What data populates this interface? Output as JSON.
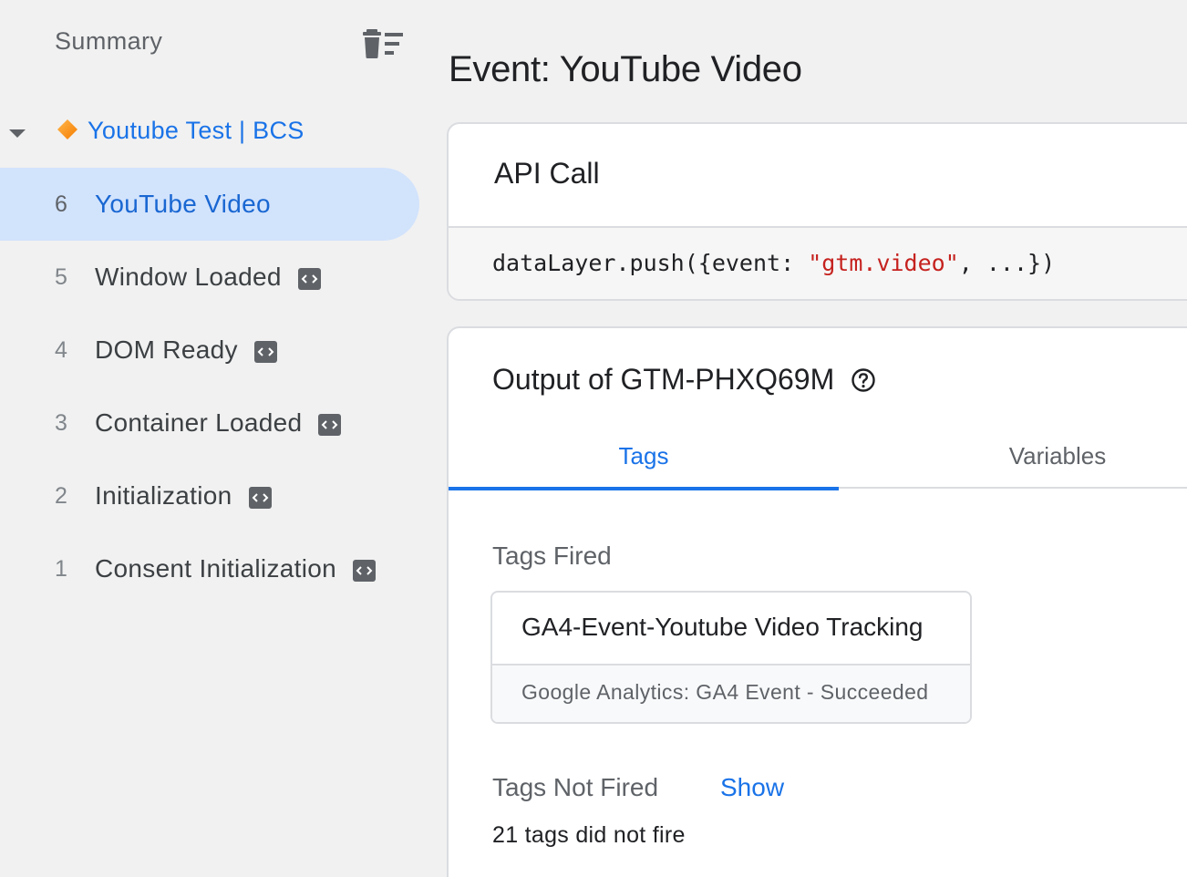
{
  "sidebar": {
    "summary_label": "Summary",
    "container": {
      "name": "Youtube Test | BCS",
      "icon": "orange-diamond-icon"
    },
    "events": [
      {
        "num": "6",
        "label": "YouTube Video",
        "active": true,
        "has_code_badge": false
      },
      {
        "num": "5",
        "label": "Window Loaded",
        "active": false,
        "has_code_badge": true
      },
      {
        "num": "4",
        "label": "DOM Ready",
        "active": false,
        "has_code_badge": true
      },
      {
        "num": "3",
        "label": "Container Loaded",
        "active": false,
        "has_code_badge": true
      },
      {
        "num": "2",
        "label": "Initialization",
        "active": false,
        "has_code_badge": true
      },
      {
        "num": "1",
        "label": "Consent Initialization",
        "active": false,
        "has_code_badge": true
      }
    ]
  },
  "main": {
    "title": "Event: YouTube Video",
    "api_call": {
      "title": "API Call",
      "code_prefix": "dataLayer.push({event: ",
      "code_string": "\"gtm.video\"",
      "code_suffix": ", ...})"
    },
    "output": {
      "title": "Output of GTM-PHXQ69M",
      "tabs": [
        {
          "label": "Tags",
          "active": true
        },
        {
          "label": "Variables",
          "active": false
        }
      ],
      "tags_fired_label": "Tags Fired",
      "fired_tags": [
        {
          "name": "GA4-Event-Youtube Video Tracking",
          "status": "Google Analytics: GA4 Event - Succeeded"
        }
      ],
      "tags_not_fired_label": "Tags Not Fired",
      "show_label": "Show",
      "not_fired_count_text": "21 tags did not fire"
    }
  },
  "colors": {
    "accent": "#1a73e8",
    "active_bg": "#d2e3fc",
    "code_string": "#c5221f",
    "container_icon": "#f9a825"
  }
}
